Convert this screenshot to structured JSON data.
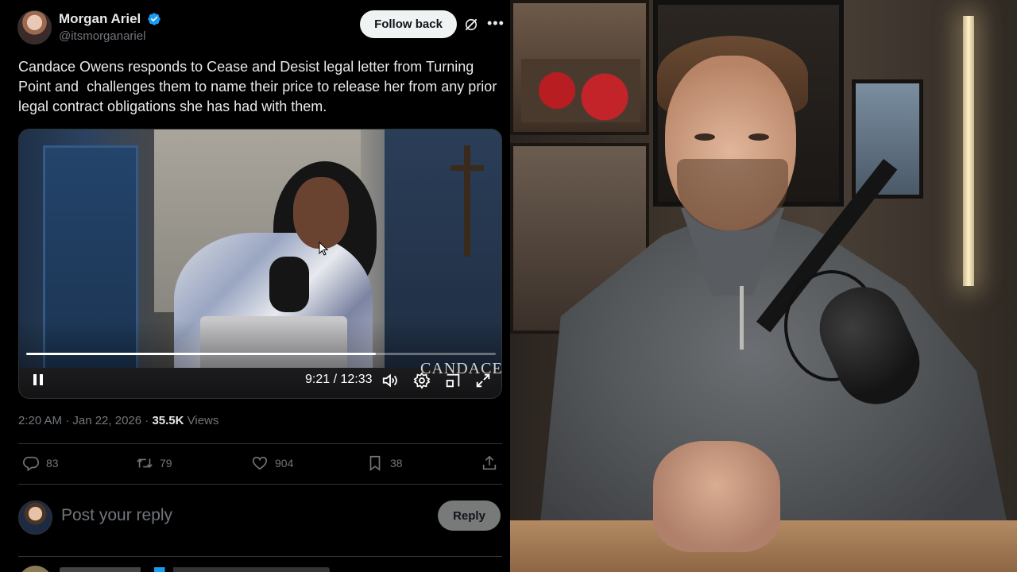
{
  "tweet": {
    "author": {
      "display_name": "Morgan Ariel",
      "handle": "@itsmorganariel",
      "verified": true
    },
    "follow_button_label": "Follow back",
    "text": "Candace Owens responds to Cease and Desist legal letter from Turning Point and  challenges them to name their price to release her from any prior legal contract obligations she has had with them.",
    "video": {
      "current_time": "9:21",
      "duration": "12:33",
      "time_readout": "9:21 / 12:33",
      "progress_fraction": 0.745,
      "watermark": "CANDACE",
      "state": "playing"
    },
    "meta": {
      "timestamp": "2:20 AM · Jan 22, 2026 · ",
      "views_count": "35.5K",
      "views_label": " Views"
    },
    "actions": {
      "replies": "83",
      "reposts": "79",
      "likes": "904",
      "bookmarks": "38"
    }
  },
  "reply_box": {
    "placeholder": "Post your reply",
    "button_label": "Reply"
  },
  "colors": {
    "background": "#000000",
    "text_primary": "#e7e9ea",
    "text_secondary": "#71767b",
    "verified_blue": "#1d9bf0",
    "divider": "#2f3336"
  },
  "icons": [
    "verified-icon",
    "grok-icon",
    "more-icon",
    "pause-icon",
    "volume-icon",
    "settings-icon",
    "pip-icon",
    "fullscreen-icon",
    "reply-icon",
    "repost-icon",
    "like-icon",
    "bookmark-icon",
    "share-icon"
  ]
}
